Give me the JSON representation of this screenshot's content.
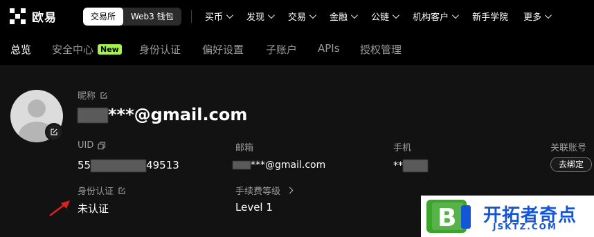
{
  "brand": {
    "name": "欧易"
  },
  "switcher": {
    "exchange": "交易所",
    "web3": "Web3 钱包"
  },
  "nav": [
    {
      "label": "买币",
      "dropdown": true
    },
    {
      "label": "发现",
      "dropdown": true
    },
    {
      "label": "交易",
      "dropdown": true
    },
    {
      "label": "金融",
      "dropdown": true
    },
    {
      "label": "公链",
      "dropdown": true
    },
    {
      "label": "机构客户",
      "dropdown": true
    },
    {
      "label": "新手学院",
      "dropdown": false
    },
    {
      "label": "更多",
      "dropdown": true
    }
  ],
  "tabs": {
    "overview": "总览",
    "security": "安全中心",
    "security_badge": "New",
    "identity": "身份认证",
    "preferences": "偏好设置",
    "subaccount": "子账户",
    "apis": "APIs",
    "authorization": "授权管理"
  },
  "profile": {
    "nickname_label": "昵称",
    "nickname_value": "***@gmail.com",
    "uid_label": "UID",
    "uid_prefix": "55",
    "uid_suffix": "49513",
    "email_label": "邮箱",
    "email_value": "***@gmail.com",
    "phone_label": "手机",
    "phone_value": "**",
    "linked_label": "关联账号",
    "unbind_button": "去绑定",
    "identity_label": "身份认证",
    "identity_value": "未认证",
    "fee_label": "手续费等级",
    "fee_value": "Level 1"
  },
  "watermark": {
    "title": "开拓者奇点",
    "subtitle": "JSKTZ.COM"
  },
  "colors": {
    "background": "#000000",
    "panel": "#121212",
    "badge_new": "#a6f24c",
    "annotation_arrow": "#e02020",
    "watermark_blue": "#1457d6",
    "watermark_green": "#3aa52a"
  }
}
